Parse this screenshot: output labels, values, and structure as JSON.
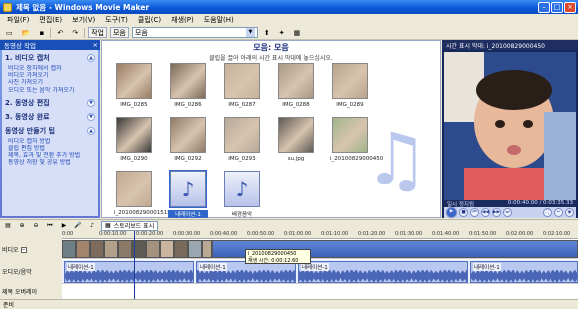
{
  "window": {
    "title": "제목 없음 - Windows Movie Maker"
  },
  "menu": [
    "파일(F)",
    "편집(E)",
    "보기(V)",
    "도구(T)",
    "클립(C)",
    "재생(P)",
    "도움말(H)"
  ],
  "toolbar": {
    "tasks_label": "작업",
    "collections_label": "모음",
    "collection_select": "모음"
  },
  "tasks": {
    "header": "동영상 작업",
    "groups": [
      {
        "title": "1. 비디오 캡처",
        "links": [
          "비디오 장치에서 캡처",
          "비디오 가져오기",
          "사진 가져오기",
          "오디오 또는 음악 가져오기"
        ]
      },
      {
        "title": "2. 동영상 편집",
        "links": []
      },
      {
        "title": "3. 동영상 완료",
        "links": []
      },
      {
        "title": "동영상 만들기 팁",
        "links": [
          "비디오 캡처 방법",
          "클립 편집 방법",
          "제목, 효과 및 전환 추가 방법",
          "동영상 저장 및 공유 방법"
        ]
      }
    ]
  },
  "collection": {
    "title": "모음: 모음",
    "subtitle": "클립을 끌어 아래의 시간 표시 막대에 놓으십시오.",
    "clips": [
      {
        "name": "IMG_0285",
        "kind": "photo",
        "color": "#9a7c64"
      },
      {
        "name": "IMG_0286",
        "kind": "photo",
        "color": "#7b6a58"
      },
      {
        "name": "IMG_0287",
        "kind": "photo",
        "color": "#c7b39a"
      },
      {
        "name": "IMG_0288",
        "kind": "photo",
        "color": "#a89884"
      },
      {
        "name": "IMG_0289",
        "kind": "photo",
        "color": "#b9a48b"
      },
      {
        "name": "IMG_0290",
        "kind": "photo",
        "color": "#3a3a3a"
      },
      {
        "name": "IMG_0292",
        "kind": "photo",
        "color": "#8e7a66"
      },
      {
        "name": "IMG_0293",
        "kind": "photo",
        "color": "#b6a999"
      },
      {
        "name": "su.jpg",
        "kind": "photo",
        "color": "#5d5a55"
      },
      {
        "name": "i_20100829000450",
        "kind": "photo",
        "color": "#a2b58c"
      },
      {
        "name": "i_201008290001515",
        "kind": "photo",
        "color": "#c2a890"
      },
      {
        "name": "내레이션-1",
        "kind": "audio",
        "selected": true
      },
      {
        "name": "배경음악",
        "kind": "audio"
      }
    ]
  },
  "preview": {
    "header": "시간 표시 막대: i_20100829000450",
    "status_left": "일시 정지됨",
    "time": "0:00:40.00 / 0:03:35.33"
  },
  "timeline": {
    "storyboard_label": "스토리보드 표시",
    "ruler": [
      "0:00",
      "0:00:10.00",
      "0:00:20.00",
      "0:00:30.00",
      "0:00:40.00",
      "0:00:50.00",
      "0:01:00.00",
      "0:01:10.00",
      "0:01:20.00",
      "0:01:30.00",
      "0:01:40.00",
      "0:01:50.00",
      "0:02:00.00",
      "0:02:10.00"
    ],
    "tracks": {
      "video": "비디오",
      "audio": "오디오/음악",
      "title": "제목 오버레이"
    },
    "tooltip": {
      "name": "i_20100829000450",
      "duration": "재생 시간: 0:00:12.60"
    },
    "audio_clips": [
      "내레이션-1",
      "내레이션-1",
      "내레이션-1",
      "내레이션-1"
    ]
  },
  "status": "준비"
}
